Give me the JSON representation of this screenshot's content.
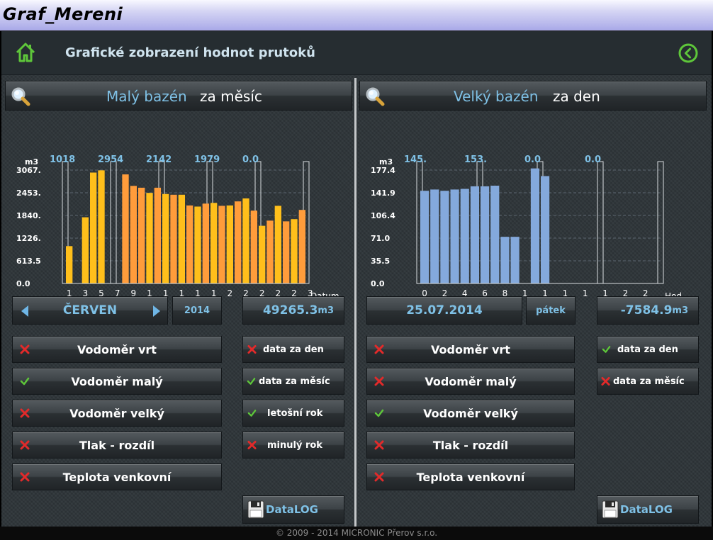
{
  "window": {
    "title": "Graf_Mereni"
  },
  "header": {
    "title": "Grafické zobrazení hodnot prutoků"
  },
  "footer": {
    "text": "© 2009 - 2014 MICRONIC Přerov s.r.o."
  },
  "colors": {
    "accent": "#7fc1e6",
    "green": "#5ec63a",
    "red": "#e32a2a",
    "bar_orange": "#ff9c3b",
    "bar_yellow": "#ffbf1b",
    "bar_blue": "#84a9dc"
  },
  "left": {
    "panel_name": "Malý bazén",
    "period": "za měsíc",
    "month": "ČERVEN",
    "year": "2014",
    "total_value": "49265.3",
    "total_unit": "m3",
    "signals": [
      {
        "label": "Vodoměr vrt",
        "checked": false
      },
      {
        "label": "Vodoměr malý",
        "checked": true
      },
      {
        "label": "Vodoměr velký",
        "checked": false
      },
      {
        "label": "Tlak - rozdíl",
        "checked": false
      },
      {
        "label": "Teplota venkovní",
        "checked": false
      }
    ],
    "options": [
      {
        "label": "data za den",
        "checked": false
      },
      {
        "label": "data za měsíc",
        "checked": true
      },
      {
        "label": "letošní rok",
        "checked": true
      },
      {
        "label": "minulý rok",
        "checked": false
      }
    ],
    "datalog": "DataLOG"
  },
  "right": {
    "panel_name": "Velký bazén",
    "period": "za den",
    "date": "25.07.2014",
    "weekday": "pátek",
    "total_value": "-7584.9",
    "total_unit": "m3",
    "signals": [
      {
        "label": "Vodoměr vrt",
        "checked": false
      },
      {
        "label": "Vodoměr malý",
        "checked": false
      },
      {
        "label": "Vodoměr velký",
        "checked": true
      },
      {
        "label": "Tlak - rozdíl",
        "checked": false
      },
      {
        "label": "Teplota venkovní",
        "checked": false
      }
    ],
    "options": [
      {
        "label": "data za den",
        "checked": true
      },
      {
        "label": "data za měsíc",
        "checked": false
      }
    ],
    "datalog": "DataLOG"
  },
  "chart_data": [
    {
      "type": "bar",
      "ylabel": "m3",
      "xlabel": "Datum",
      "ylim": [
        0,
        3067
      ],
      "yticks": [
        "0.0",
        "613.5",
        "1226.",
        "1840.",
        "2453.",
        "3067."
      ],
      "y_tick_values": [
        0,
        613.5,
        1226,
        1840,
        2453,
        3067
      ],
      "categories": [
        "1",
        "2",
        "3",
        "4",
        "5",
        "6",
        "7",
        "8",
        "9",
        "10",
        "11",
        "12",
        "13",
        "14",
        "15",
        "16",
        "17",
        "18",
        "19",
        "20",
        "21",
        "22",
        "23",
        "24",
        "25",
        "26",
        "27",
        "28",
        "29",
        "30"
      ],
      "x_tick_labels": [
        "1",
        "3",
        "5",
        "7",
        "9",
        "11",
        "13",
        "15",
        "17",
        "19",
        "21",
        "23",
        "25",
        "27",
        "29",
        "31"
      ],
      "values": [
        1010,
        0,
        1790,
        3000,
        3060,
        0,
        0,
        2950,
        2640,
        2590,
        2450,
        2590,
        2420,
        2400,
        2400,
        2110,
        2080,
        2160,
        2180,
        2100,
        2110,
        2220,
        2300,
        1970,
        1560,
        1700,
        2100,
        1680,
        1740,
        1990
      ],
      "orange_days": [
        8,
        9,
        10,
        12,
        14,
        16,
        18,
        20,
        22,
        24,
        26,
        28,
        30
      ],
      "segment_labels": [
        "1018",
        "2954",
        "2142",
        "1979",
        "0.0"
      ],
      "grid": true
    },
    {
      "type": "bar",
      "ylabel": "m3",
      "xlabel": "Hod.",
      "ylim": [
        0,
        177.4
      ],
      "yticks": [
        "0.0",
        "35.5",
        "71.0",
        "106.4",
        "141.9",
        "177.4"
      ],
      "y_tick_values": [
        0,
        35.5,
        71,
        106.4,
        141.9,
        177.4
      ],
      "categories": [
        "0",
        "1",
        "2",
        "3",
        "4",
        "5",
        "6",
        "7",
        "8",
        "9",
        "10",
        "11",
        "12",
        "13",
        "14",
        "15",
        "16",
        "17",
        "18",
        "19",
        "20",
        "21",
        "22",
        "23"
      ],
      "x_tick_labels": [
        "0",
        "2",
        "4",
        "6",
        "8",
        "10",
        "12",
        "14",
        "16",
        "18",
        "20",
        "22"
      ],
      "values": [
        145,
        147,
        145,
        147,
        148,
        152,
        152,
        153,
        73,
        73,
        0,
        180,
        168,
        0,
        0,
        0,
        0,
        0,
        0,
        0,
        0,
        0,
        0,
        0
      ],
      "segment_labels": [
        "145.",
        "153.",
        "0.0",
        "0.0"
      ],
      "grid": true
    }
  ]
}
